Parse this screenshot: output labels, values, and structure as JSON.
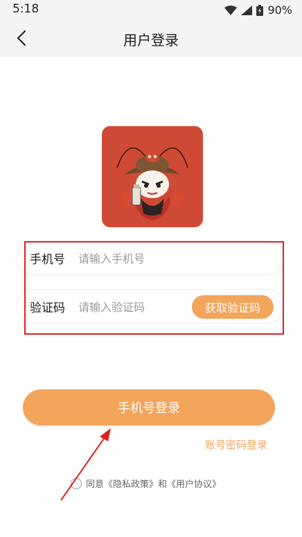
{
  "status_bar": {
    "time": "5:18",
    "battery": "90%"
  },
  "header": {
    "title": "用户登录"
  },
  "form": {
    "phone_label": "手机号",
    "phone_placeholder": "请输入手机号",
    "code_label": "验证码",
    "code_placeholder": "请输入验证码",
    "get_code_label": "获取验证码"
  },
  "actions": {
    "login_label": "手机号登录",
    "password_login_label": "账号密码登录"
  },
  "agreement": {
    "prefix": "同意",
    "privacy_label": "《隐私政策》",
    "conjunction": "和",
    "user_agreement_label": "《用户协议》"
  },
  "colors": {
    "accent": "#f2a55b",
    "annotation_red": "#e01f1f",
    "avatar_bg": "#cf4a35"
  },
  "icons": {
    "back": "chevron-left-icon",
    "wifi": "wifi-icon",
    "signal": "signal-icon",
    "battery": "battery-icon"
  }
}
